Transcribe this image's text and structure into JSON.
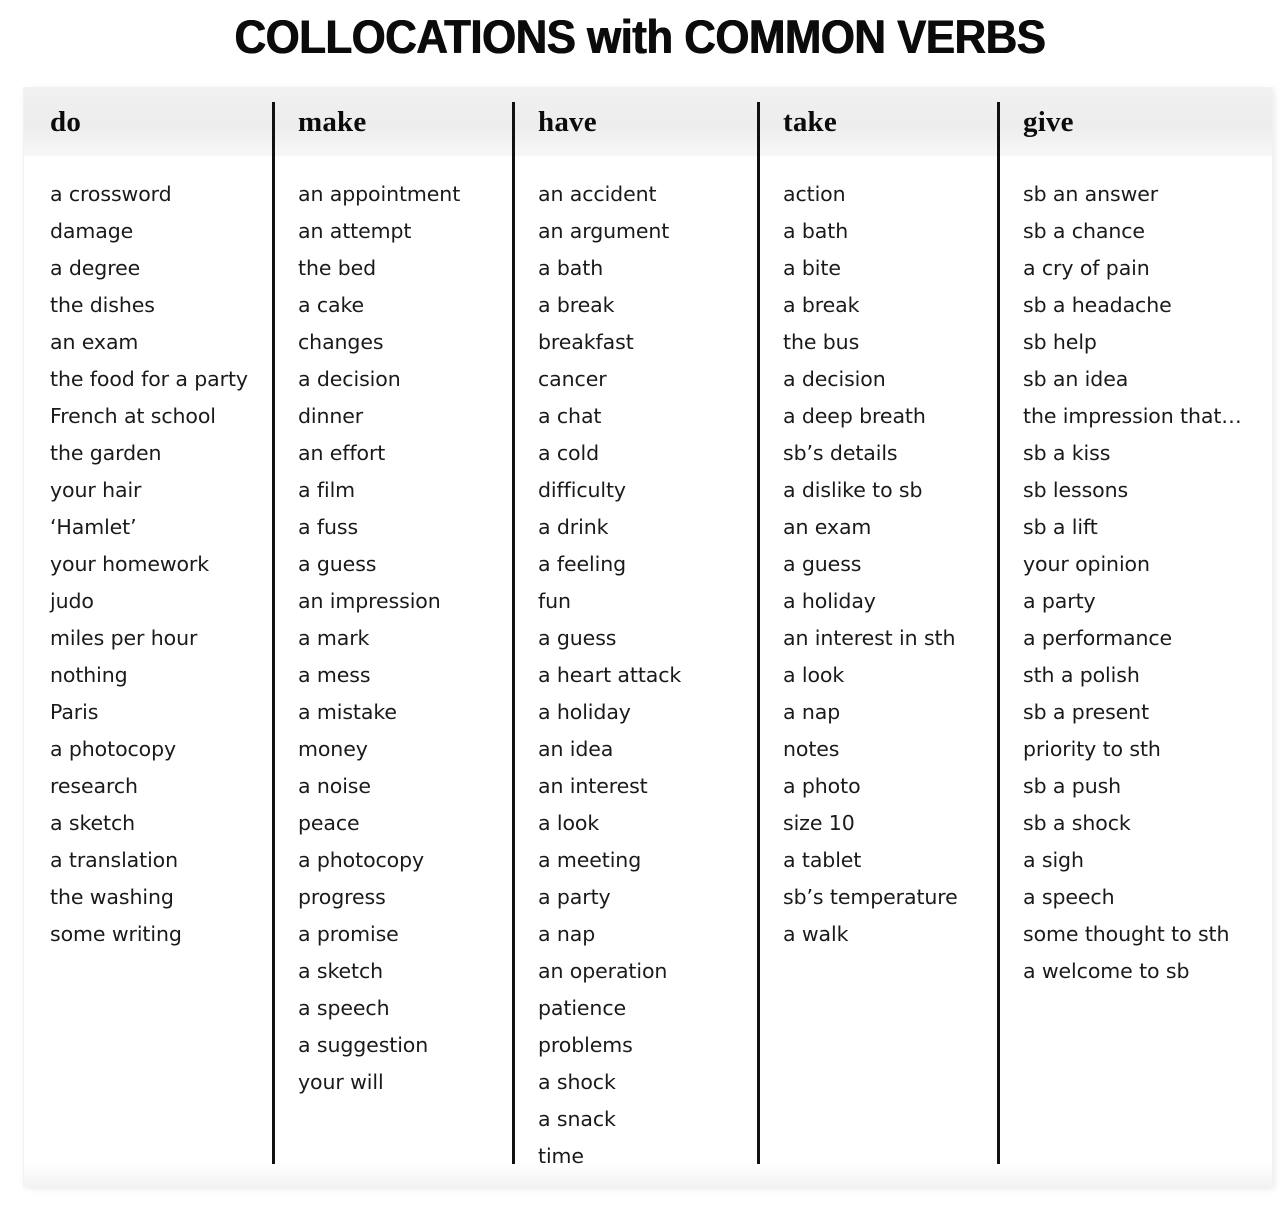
{
  "title": "COLLOCATIONS with COMMON VERBS",
  "colors": {
    "ink": "#0c0c0c",
    "text": "#1a1a1a",
    "rule": "#111111",
    "page": "#ffffff",
    "header_band": "#eeeeee"
  },
  "columns": [
    {
      "verb": "do",
      "items": [
        "a crossword",
        "damage",
        "a degree",
        "the dishes",
        "an exam",
        "the food for a party",
        "French at school",
        "the garden",
        "your hair",
        "‘Hamlet’",
        "your homework",
        "judo",
        "miles per hour",
        "nothing",
        "Paris",
        "a photocopy",
        "research",
        "a sketch",
        "a translation",
        "the washing",
        "some writing"
      ]
    },
    {
      "verb": "make",
      "items": [
        "an appointment",
        "an attempt",
        "the bed",
        "a cake",
        "changes",
        "a decision",
        "dinner",
        "an effort",
        "a film",
        "a fuss",
        "a guess",
        "an impression",
        "a mark",
        "a mess",
        "a mistake",
        "money",
        "a noise",
        "peace",
        "a photocopy",
        "progress",
        "a promise",
        "a sketch",
        "a speech",
        "a suggestion",
        "your will"
      ]
    },
    {
      "verb": "have",
      "items": [
        "an accident",
        "an argument",
        "a bath",
        "a break",
        "breakfast",
        "cancer",
        "a chat",
        "a cold",
        "difficulty",
        "a drink",
        "a feeling",
        "fun",
        "a guess",
        "a heart attack",
        "a holiday",
        "an idea",
        "an interest",
        "a look",
        "a meeting",
        "a party",
        "a nap",
        "an operation",
        "patience",
        "problems",
        "a shock",
        "a snack",
        "time"
      ]
    },
    {
      "verb": "take",
      "items": [
        "action",
        "a bath",
        "a bite",
        "a break",
        "the bus",
        "a decision",
        "a deep breath",
        "sb’s details",
        "a dislike to sb",
        "an exam",
        "a guess",
        "a holiday",
        "an interest in sth",
        "a look",
        "a nap",
        "notes",
        "a photo",
        "size 10",
        "a tablet",
        "sb’s temperature",
        "a walk"
      ]
    },
    {
      "verb": "give",
      "items": [
        "sb an answer",
        "sb a chance",
        "a cry of pain",
        "sb a headache",
        "sb help",
        "sb an idea",
        "the impression that…",
        "sb a kiss",
        "sb lessons",
        "sb a lift",
        "your opinion",
        "a party",
        "a performance",
        "sth a polish",
        "sb a present",
        "priority to sth",
        "sb a push",
        "sb a shock",
        "a sigh",
        "a speech",
        "some thought to sth",
        "a welcome to sb"
      ]
    }
  ]
}
